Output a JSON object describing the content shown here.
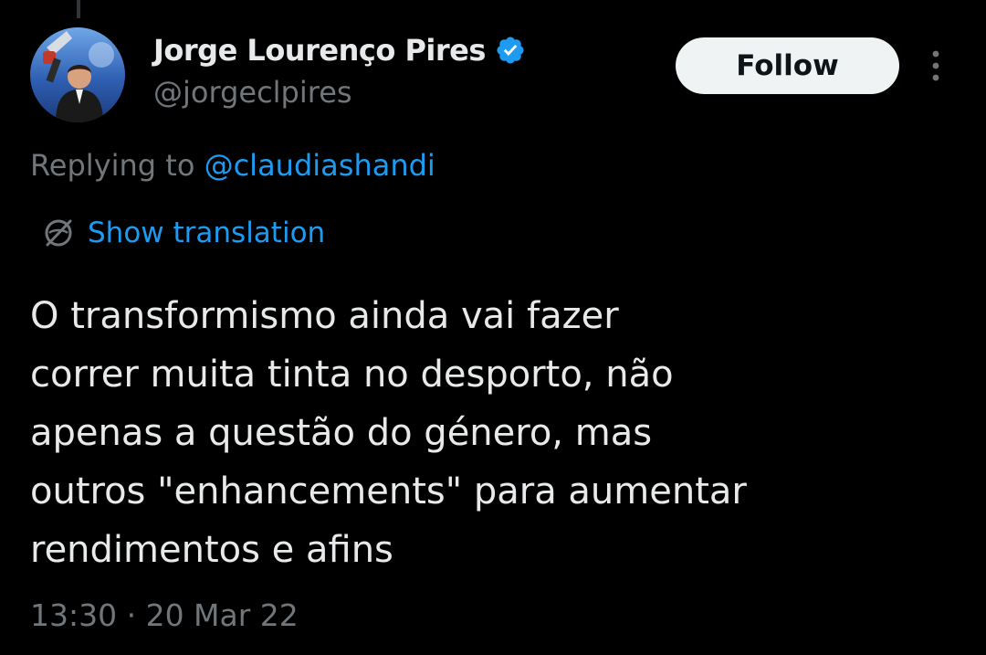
{
  "author": {
    "display_name": "Jorge Lourenço Pires",
    "handle": "@jorgeclpires",
    "verified": true,
    "verified_icon": "verified-badge-icon",
    "avatar_icon": "avatar"
  },
  "actions": {
    "follow_label": "Follow",
    "more_icon": "more-vertical-icon"
  },
  "reply": {
    "prefix": "Replying to ",
    "mention": "@claudiashandi"
  },
  "translation": {
    "icon": "globe-slash-icon",
    "label": "Show translation"
  },
  "tweet": {
    "lines": [
      "O transformismo ainda vai fazer",
      "correr muita tinta no desporto, não",
      "apenas a questão do género, mas",
      "outros \"enhancements\" para aumentar",
      "rendimentos e afins"
    ],
    "timestamp": "13:30 · 20 Mar 22"
  },
  "colors": {
    "background": "#000000",
    "primary_text": "#e7e9ea",
    "secondary_text": "#71767b",
    "accent": "#1d9bf0",
    "follow_button_bg": "#eff3f4",
    "follow_button_text": "#0f1419"
  }
}
